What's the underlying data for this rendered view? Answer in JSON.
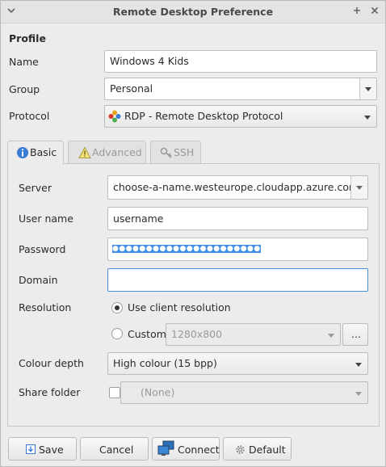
{
  "window": {
    "title": "Remote Desktop Preference"
  },
  "profile": {
    "heading": "Profile",
    "name_label": "Name",
    "name_value": "Windows 4 Kids",
    "group_label": "Group",
    "group_value": "Personal",
    "protocol_label": "Protocol",
    "protocol_value": "RDP - Remote Desktop Protocol"
  },
  "tabs": [
    {
      "label": "Basic",
      "active": true,
      "icon": "info-icon"
    },
    {
      "label": "Advanced",
      "active": false,
      "icon": "warning-icon"
    },
    {
      "label": "SSH",
      "active": false,
      "icon": "key-icon"
    }
  ],
  "basic": {
    "server_label": "Server",
    "server_value": "choose-a-name.westeurope.cloudapp.azure.com",
    "username_label": "User name",
    "username_value": "username",
    "password_label": "Password",
    "password_value": "●●●●●●●●●●●●●●●●●●●●●●",
    "domain_label": "Domain",
    "domain_value": "",
    "resolution_label": "Resolution",
    "use_client_label": "Use client resolution",
    "use_client_selected": true,
    "custom_label": "Custom",
    "custom_value": "1280x800",
    "custom_more": "...",
    "colour_label": "Colour depth",
    "colour_value": "High colour (15 bpp)",
    "share_label": "Share folder",
    "share_checked": false,
    "share_value": "(None)"
  },
  "buttons": {
    "save": "Save",
    "cancel": "Cancel",
    "connect": "Connect",
    "default": "Default"
  }
}
